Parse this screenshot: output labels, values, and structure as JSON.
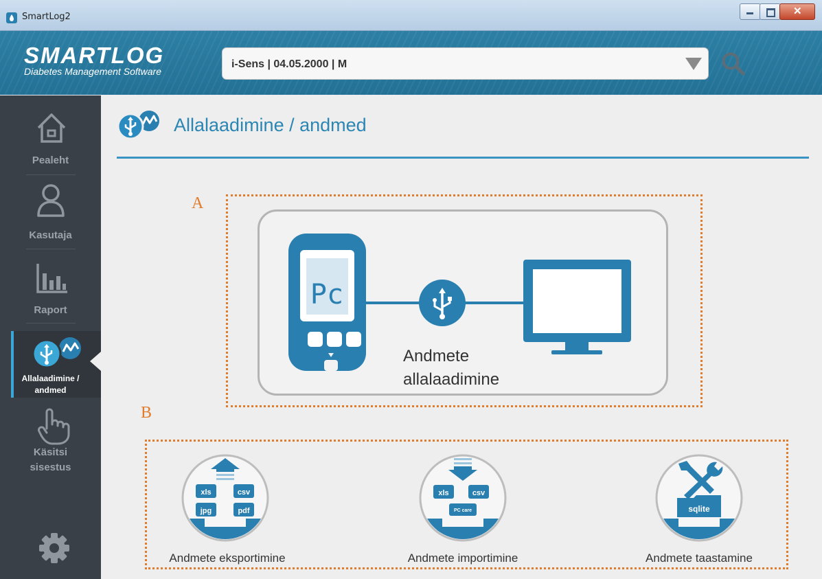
{
  "window": {
    "title": "SmartLog2"
  },
  "header": {
    "brand": "SMARTLOG",
    "tagline": "Diabetes Management Software",
    "patient_selector": "i-Sens | 04.05.2000 | M"
  },
  "sidebar": {
    "items": [
      {
        "label": "Pealeht",
        "icon": "home-icon"
      },
      {
        "label": "Kasutaja",
        "icon": "user-icon"
      },
      {
        "label": "Raport",
        "icon": "chart-icon"
      },
      {
        "label_line1": "Allalaadimine /",
        "label_line2": "andmed",
        "icon": "download-data-icon",
        "active": true
      },
      {
        "label_line1": "Käsitsi",
        "label_line2": "sisestus",
        "icon": "hand-pointer-icon"
      },
      {
        "icon": "gear-icon"
      }
    ]
  },
  "main": {
    "title": "Allalaadimine / andmed",
    "annotation_a": "A",
    "annotation_b": "B",
    "download": {
      "line1": "Andmete",
      "line2": "allalaadimine",
      "meter_display": "Pc"
    },
    "actions": [
      {
        "label": "Andmete eksportimine",
        "tags": [
          "xls",
          "csv",
          "jpg",
          "pdf"
        ]
      },
      {
        "label": "Andmete importimine",
        "tags": [
          "xls",
          "csv",
          "PC care"
        ]
      },
      {
        "label": "Andmete taastamine",
        "tags": [
          "sqlite"
        ]
      }
    ]
  },
  "colors": {
    "accent": "#2b86b3",
    "sidebar": "#3a4047",
    "annotation": "#e07c2c",
    "icon_blue": "#2a7fb1"
  }
}
